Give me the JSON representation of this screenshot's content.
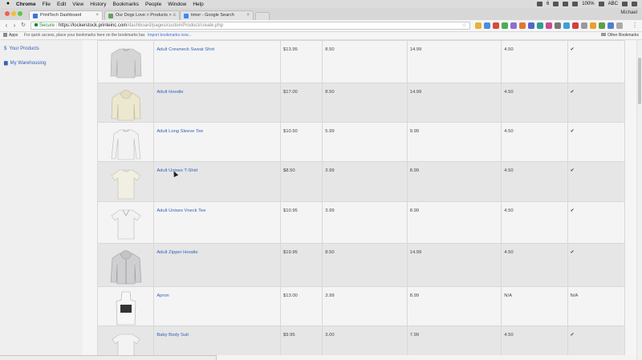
{
  "menubar": {
    "app": "Chrome",
    "items": [
      "File",
      "Edit",
      "View",
      "History",
      "Bookmarks",
      "People",
      "Window",
      "Help"
    ],
    "status_battery": "100%",
    "status_count": "6",
    "status_lang": "ABC"
  },
  "tabs": [
    {
      "label": "PrintTech Dashboard",
      "color": "#3a74d8"
    },
    {
      "label": "Our Dogs Love > Products > ...",
      "color": "#5aa65a"
    },
    {
      "label": "timer - Google Search",
      "color": "#4285f4"
    }
  ],
  "profile_name": "Michael",
  "omnibox": {
    "secure_label": "Secure",
    "url_host": "https://lockerstock.printeinc.com",
    "url_path": "/dashboard/pages/customProduct/create.php"
  },
  "bookmarks_bar": {
    "apps_label": "Apps",
    "hint": "For quick access, place your bookmarks here on the bookmarks bar.",
    "import_link": "Import bookmarks now...",
    "other_label": "Other Bookmarks"
  },
  "sidebar": {
    "items": [
      {
        "icon": "dollar-icon",
        "label": "Your Products"
      },
      {
        "icon": "truck-icon",
        "label": "My Warehousing"
      }
    ]
  },
  "products": [
    {
      "name": "Adult Crewneck Sweat Shirt",
      "price": "$13.95",
      "c1": "8.50",
      "c2": "14.99",
      "c3": "4.50",
      "c4": "✔",
      "garment": "sweatshirt"
    },
    {
      "name": "Adult Hoodie",
      "price": "$17.00",
      "c1": "8.50",
      "c2": "14.99",
      "c3": "4.50",
      "c4": "✔",
      "garment": "hoodie"
    },
    {
      "name": "Adult Long Sleeve Tee",
      "price": "$10.50",
      "c1": "5.99",
      "c2": "9.99",
      "c3": "4.50",
      "c4": "✔",
      "garment": "longsleeve"
    },
    {
      "name": "Adult Unisex T-Shirt",
      "price": "$8.50",
      "c1": "3.99",
      "c2": "8.99",
      "c3": "4.50",
      "c4": "✔",
      "garment": "tshirt"
    },
    {
      "name": "Adult Unisex Vneck Tee",
      "price": "$10.95",
      "c1": "3.99",
      "c2": "8.99",
      "c3": "4.50",
      "c4": "✔",
      "garment": "vneck"
    },
    {
      "name": "Adult Zipper Hoodie",
      "price": "$19.95",
      "c1": "8.50",
      "c2": "14.99",
      "c3": "4.50",
      "c4": "✔",
      "garment": "ziphoodie"
    },
    {
      "name": "Apron",
      "price": "$13.00",
      "c1": "3.99",
      "c2": "8.99",
      "c3": "N/A",
      "c4": "N/A",
      "garment": "apron"
    },
    {
      "name": "Baby Body Suit",
      "price": "$9.95",
      "c1": "3.00",
      "c2": "7.99",
      "c3": "4.50",
      "c4": "✔",
      "garment": "bodysuit"
    }
  ]
}
